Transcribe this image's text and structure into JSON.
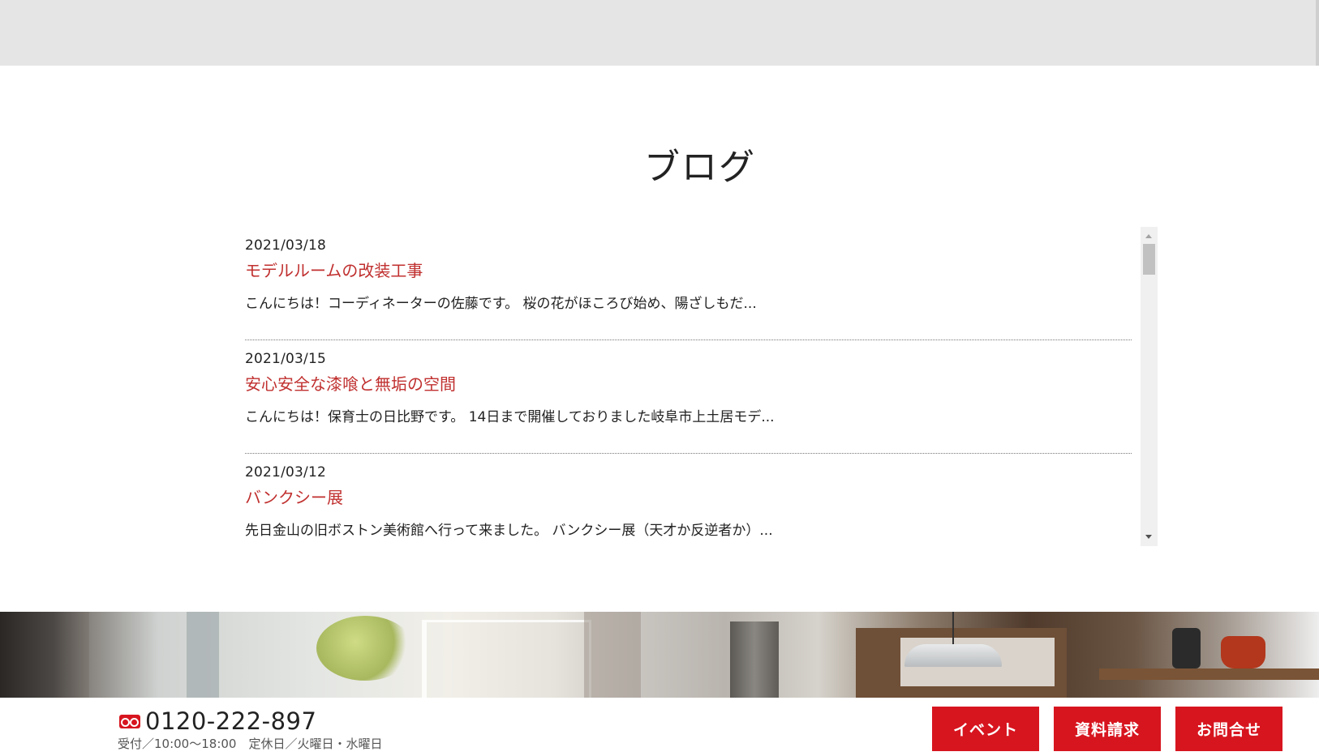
{
  "section": {
    "title": "ブログ"
  },
  "posts": [
    {
      "date": "2021/03/18",
      "title": "モデルルームの改装工事",
      "excerpt": "こんにちは！コーディネーターの佐藤です。 桜の花がほころび始め、陽ざしもだ..."
    },
    {
      "date": "2021/03/15",
      "title": "安心安全な漆喰と無垢の空間",
      "excerpt": "こんにちは！保育士の日比野です。 14日まで開催しておりました岐阜市上土居モデ..."
    },
    {
      "date": "2021/03/12",
      "title": "バンクシー展",
      "excerpt": "先日金山の旧ボストン美術館へ行って来ました。 バンクシー展（天才か反逆者か）..."
    }
  ],
  "footer": {
    "phone": "0120-222-897",
    "hours": "受付／10:00〜18:00　定休日／火曜日・水曜日",
    "buttons": {
      "event": "イベント",
      "documents": "資料請求",
      "contact": "お問合せ"
    }
  },
  "colors": {
    "accent": "#d7151f",
    "link": "#c0302f",
    "top_band": "#e5e5e5"
  },
  "icons": {
    "freedial": "freedial-icon"
  }
}
